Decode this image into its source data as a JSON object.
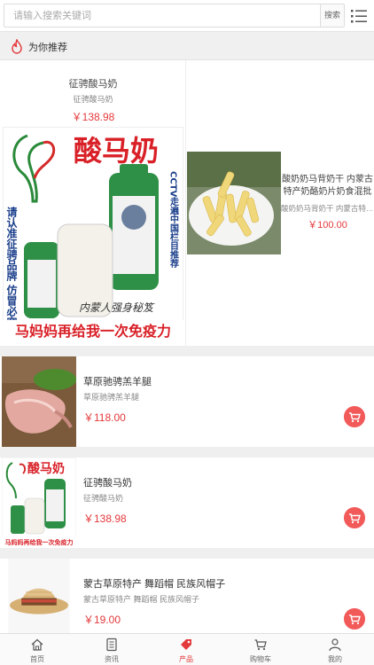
{
  "search": {
    "placeholder": "请输入搜索关键词",
    "button_label": "搜索"
  },
  "section": {
    "title": "为你推荐"
  },
  "recommend": [
    {
      "name": "征骋酸马奶",
      "subtitle": "征骋酸马奶",
      "price": "￥138.98",
      "image_text": {
        "headline": "酸马奶",
        "side_left": "请认准征骋品牌 仿冒必究",
        "side_right": "CCTV走遍中国栏目推荐",
        "slogan": "内蒙人强身秘笈",
        "footer": "马妈妈再给我一次免疫力"
      }
    },
    {
      "name": "酸奶奶马背奶干 内蒙古特产奶酪奶片奶食混批",
      "subtitle": "酸奶奶马背奶干 内蒙古特产奶酪奶片奶食混批",
      "price": "￥100.00"
    }
  ],
  "products": [
    {
      "name": "草原驰骋羔羊腿",
      "subtitle": "草原驰骋羔羊腿",
      "price": "￥118.00"
    },
    {
      "name": "征骋酸马奶",
      "subtitle": "征骋酸马奶",
      "price": "￥138.98"
    },
    {
      "name": "蒙古草原特产 舞蹈帽 民族风帽子",
      "subtitle": "蒙古草原特产 舞蹈帽 民族风帽子",
      "price": "￥19.00"
    }
  ],
  "nav": [
    {
      "label": "首页",
      "icon": "home-icon"
    },
    {
      "label": "资讯",
      "icon": "news-icon"
    },
    {
      "label": "产品",
      "icon": "tag-icon"
    },
    {
      "label": "购物车",
      "icon": "cart-icon"
    },
    {
      "label": "我的",
      "icon": "user-icon"
    }
  ],
  "colors": {
    "accent": "#e4393c",
    "cart_button": "#f25a5a",
    "background": "#efefef"
  }
}
